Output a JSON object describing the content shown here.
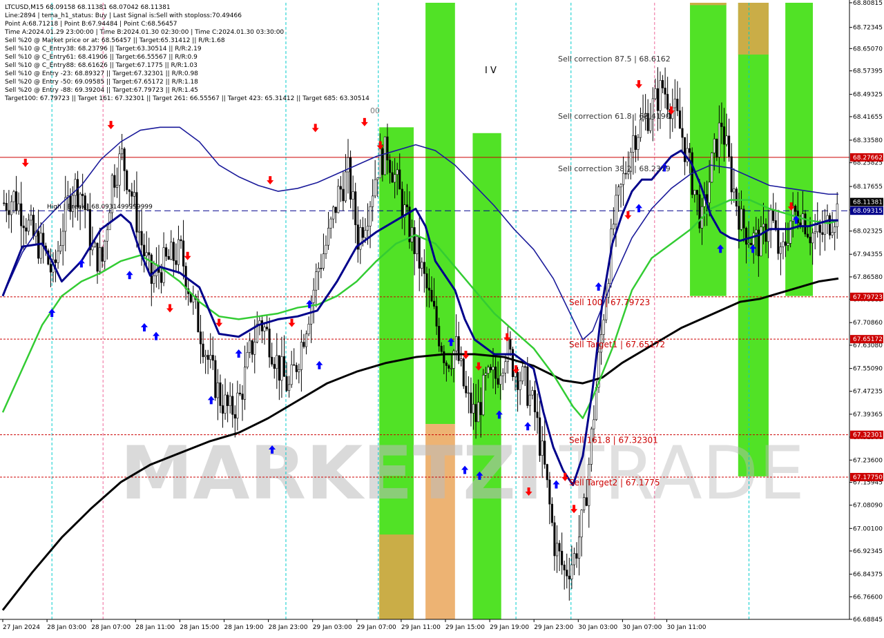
{
  "header": {
    "lines": [
      "LTCUSD,M15  68.09158 68.11381 68.07042 68.11381",
      "Line:2894  |  tema_h1_status: Buy  |  Last Signal is:Sell with stoploss:70.49466",
      "Point A:68.71218  |  Point B:67.94484  |  Point C:68.56457",
      "Time A:2024.01.29 23:00:00  |  Time B:2024.01.30 02:30:00  |  Time C:2024.01.30 03:30:00",
      "Sell %20 @ Market price or at: 68.56457  ||  Target:65.31412  ||  R/R:1.68",
      "Sell %10 @ C_Entry38: 68.23796  ||  Target:63.30514  ||  R/R:2.19",
      "Sell %10 @ C_Entry61: 68.41906  ||  Target:66.55567  ||  R/R:0.9",
      "Sell %10 @ C_Entry88: 68.61626  ||  Target:67.1775  ||  R/R:1.03",
      "Sell %10 @ Entry -23: 68.89327  ||  Target:67.32301  ||  R/R:0.98",
      "Sell %20 @ Entry -50: 69.09585  ||  Target:67.65172  ||  R/R:1.18",
      "Sell %20 @ Entry -88: 69.39204  ||  Target:67.79723  ||  R/R:1.45",
      "Target100: 67.79723  ||  Target 161: 67.32301  ||  Target 261: 66.55567  ||  Target 423: 65.31412  ||  Target 685: 63.30514"
    ]
  },
  "watermark": {
    "left": "MARKETZI",
    "right": "TRADE"
  },
  "wave_label": "I V",
  "partial_label": "00",
  "colors": {
    "background": "#ffffff",
    "plot_bg": "#ffffff",
    "zone_green": "#33dd00",
    "zone_orange": "#e8a050",
    "bull_body": "#ffffff",
    "bear_body": "#000000",
    "wick": "#000000",
    "ma_fast": "#00008b",
    "ma_mid": "#1a1a9a",
    "ma_green": "#33cc33",
    "ma_slow": "#000000",
    "level_red": "#cc0000",
    "bid_line": "#00008b",
    "arrow_up": "#0000ff",
    "arrow_down": "#ff0000",
    "tag_red_bg": "#cc0000",
    "tag_blue_bg": "#00008b"
  },
  "chart_data": {
    "type": "candlestick",
    "symbol": "LTCUSD",
    "timeframe": "M15",
    "ylim": [
      66.6884,
      68.8081
    ],
    "y_ticks": [
      "68.80815",
      "68.72345",
      "68.65070",
      "68.57395",
      "68.49325",
      "68.41655",
      "68.33580",
      "68.25825",
      "68.17655",
      "68.09585",
      "68.02325",
      "67.94355",
      "67.86580",
      "67.78885",
      "67.70860",
      "67.63080",
      "67.55090",
      "67.47235",
      "67.39365",
      "67.31500",
      "67.23600",
      "67.15945",
      "67.08090",
      "67.00100",
      "66.92345",
      "66.84375",
      "66.76600",
      "66.68845"
    ],
    "x_ticks": [
      "27 Jan 2024",
      "28 Jan 03:00",
      "28 Jan 07:00",
      "28 Jan 11:00",
      "28 Jan 15:00",
      "28 Jan 19:00",
      "28 Jan 23:00",
      "29 Jan 03:00",
      "29 Jan 07:00",
      "29 Jan 11:00",
      "29 Jan 15:00",
      "29 Jan 19:00",
      "29 Jan 23:00",
      "30 Jan 03:00",
      "30 Jan 07:00",
      "30 Jan 11:00"
    ],
    "levels": [
      {
        "name": "stop",
        "value": 68.27662,
        "tag": "68.27662",
        "style": "solid",
        "label": ""
      },
      {
        "name": "sell-100",
        "value": 67.79723,
        "tag": "67.79723",
        "style": "dotted",
        "label": "Sell 100 | 67.79723"
      },
      {
        "name": "sell-target1",
        "value": 67.65172,
        "tag": "67.65172",
        "style": "dotted",
        "label": "Sell Target1 | 67.65172"
      },
      {
        "name": "sell-161",
        "value": 67.32301,
        "tag": "67.32301",
        "style": "dotted",
        "label": "Sell 161.8 | 67.32301"
      },
      {
        "name": "sell-target2",
        "value": 67.1775,
        "tag": "67.17750",
        "style": "dotted",
        "label": "Sell Target2 | 67.1775"
      }
    ],
    "bid": {
      "value": 68.09315,
      "tag": "68.09315",
      "last": "68.11381",
      "label": "High | Break | 68.0931499999999"
    },
    "corrections": [
      {
        "text": "Sell correction 87.5 | 68.6162",
        "value": 68.6162
      },
      {
        "text": "Sell correction 61.8 | 68.4190",
        "value": 68.419
      },
      {
        "text": "Sell correction 38.2 | 68.2379",
        "value": 68.2379
      }
    ],
    "zones": [
      {
        "color": "green",
        "x": [
          38.3,
          41.8
        ],
        "y": [
          66.6884,
          68.38
        ]
      },
      {
        "color": "orange",
        "x": [
          38.3,
          41.8
        ],
        "y": [
          66.6884,
          66.98
        ]
      },
      {
        "color": "green",
        "x": [
          43.0,
          46.0
        ],
        "y": [
          67.36,
          68.8081
        ]
      },
      {
        "color": "orange",
        "x": [
          43.0,
          46.0
        ],
        "y": [
          66.6884,
          67.36
        ]
      },
      {
        "color": "green",
        "x": [
          47.8,
          50.7
        ],
        "y": [
          66.6884,
          68.36
        ]
      },
      {
        "color": "green",
        "x": [
          69.9,
          73.6
        ],
        "y": [
          67.8,
          68.8081
        ]
      },
      {
        "color": "orange",
        "x": [
          69.9,
          73.6
        ],
        "y": [
          68.8,
          68.8081
        ]
      },
      {
        "color": "green",
        "x": [
          74.8,
          77.9
        ],
        "y": [
          67.18,
          68.8081
        ]
      },
      {
        "color": "orange",
        "x": [
          74.8,
          77.9
        ],
        "y": [
          68.63,
          68.8081
        ]
      },
      {
        "color": "green",
        "x": [
          79.6,
          82.4
        ],
        "y": [
          67.8,
          68.8081
        ]
      }
    ],
    "cyan_markers": [
      5.0,
      28.8,
      38.2,
      52.2,
      57.8,
      75.9
    ],
    "pink_markers": [
      10.2,
      66.3
    ],
    "ma_slow": [
      [
        0,
        66.72
      ],
      [
        3,
        66.85
      ],
      [
        6,
        66.97
      ],
      [
        9,
        67.07
      ],
      [
        12,
        67.16
      ],
      [
        15,
        67.22
      ],
      [
        18,
        67.26
      ],
      [
        21,
        67.3
      ],
      [
        24,
        67.33
      ],
      [
        27,
        67.38
      ],
      [
        30,
        67.44
      ],
      [
        33,
        67.5
      ],
      [
        36,
        67.54
      ],
      [
        39,
        67.57
      ],
      [
        42,
        67.59
      ],
      [
        45,
        67.6
      ],
      [
        48,
        67.6
      ],
      [
        51,
        67.59
      ],
      [
        54,
        67.56
      ],
      [
        57,
        67.51
      ],
      [
        59,
        67.5
      ],
      [
        61,
        67.52
      ],
      [
        63,
        67.57
      ],
      [
        65,
        67.61
      ],
      [
        67,
        67.65
      ],
      [
        69,
        67.69
      ],
      [
        71,
        67.72
      ],
      [
        73,
        67.75
      ],
      [
        75,
        67.78
      ],
      [
        77,
        67.79
      ],
      [
        79,
        67.81
      ],
      [
        81,
        67.83
      ],
      [
        83,
        67.85
      ],
      [
        85,
        67.86
      ]
    ],
    "ma_green": [
      [
        0,
        67.4
      ],
      [
        2,
        67.55
      ],
      [
        4,
        67.7
      ],
      [
        6,
        67.8
      ],
      [
        8,
        67.85
      ],
      [
        10,
        67.88
      ],
      [
        12,
        67.92
      ],
      [
        14,
        67.94
      ],
      [
        16,
        67.9
      ],
      [
        18,
        67.85
      ],
      [
        20,
        67.78
      ],
      [
        22,
        67.73
      ],
      [
        24,
        67.72
      ],
      [
        26,
        67.73
      ],
      [
        28,
        67.74
      ],
      [
        30,
        67.76
      ],
      [
        32,
        67.77
      ],
      [
        34,
        67.8
      ],
      [
        36,
        67.85
      ],
      [
        38,
        67.92
      ],
      [
        40,
        67.98
      ],
      [
        42,
        68.01
      ],
      [
        44,
        67.98
      ],
      [
        46,
        67.9
      ],
      [
        48,
        67.82
      ],
      [
        50,
        67.74
      ],
      [
        52,
        67.68
      ],
      [
        54,
        67.62
      ],
      [
        56,
        67.53
      ],
      [
        58,
        67.42
      ],
      [
        59,
        67.38
      ],
      [
        60,
        67.45
      ],
      [
        62,
        67.62
      ],
      [
        64,
        67.82
      ],
      [
        66,
        67.93
      ],
      [
        68,
        67.98
      ],
      [
        70,
        68.03
      ],
      [
        72,
        68.1
      ],
      [
        74,
        68.13
      ],
      [
        76,
        68.13
      ],
      [
        78,
        68.1
      ],
      [
        80,
        68.08
      ],
      [
        82,
        68.06
      ],
      [
        84,
        68.05
      ],
      [
        85,
        68.06
      ]
    ],
    "ma_mid": [
      [
        0,
        67.8
      ],
      [
        2,
        67.95
      ],
      [
        4,
        68.05
      ],
      [
        6,
        68.12
      ],
      [
        8,
        68.18
      ],
      [
        10,
        68.27
      ],
      [
        12,
        68.33
      ],
      [
        14,
        68.37
      ],
      [
        16,
        68.38
      ],
      [
        18,
        68.38
      ],
      [
        20,
        68.33
      ],
      [
        22,
        68.25
      ],
      [
        24,
        68.21
      ],
      [
        26,
        68.18
      ],
      [
        28,
        68.16
      ],
      [
        30,
        68.17
      ],
      [
        32,
        68.19
      ],
      [
        34,
        68.22
      ],
      [
        36,
        68.25
      ],
      [
        38,
        68.28
      ],
      [
        40,
        68.3
      ],
      [
        42,
        68.32
      ],
      [
        44,
        68.3
      ],
      [
        46,
        68.25
      ],
      [
        48,
        68.18
      ],
      [
        50,
        68.11
      ],
      [
        52,
        68.03
      ],
      [
        54,
        67.96
      ],
      [
        56,
        67.86
      ],
      [
        58,
        67.72
      ],
      [
        59,
        67.65
      ],
      [
        60,
        67.68
      ],
      [
        62,
        67.85
      ],
      [
        64,
        68.0
      ],
      [
        66,
        68.1
      ],
      [
        68,
        68.17
      ],
      [
        70,
        68.22
      ],
      [
        72,
        68.25
      ],
      [
        74,
        68.24
      ],
      [
        76,
        68.21
      ],
      [
        78,
        68.18
      ],
      [
        80,
        68.17
      ],
      [
        82,
        68.16
      ],
      [
        84,
        68.15
      ],
      [
        85,
        68.15
      ]
    ],
    "ma_fast": [
      [
        0,
        67.8
      ],
      [
        2,
        67.97
      ],
      [
        4,
        67.98
      ],
      [
        5,
        67.92
      ],
      [
        6,
        67.85
      ],
      [
        8,
        67.92
      ],
      [
        10,
        68.03
      ],
      [
        12,
        68.08
      ],
      [
        13,
        68.05
      ],
      [
        14,
        67.95
      ],
      [
        15,
        67.87
      ],
      [
        16,
        67.9
      ],
      [
        18,
        67.88
      ],
      [
        20,
        67.83
      ],
      [
        21,
        67.75
      ],
      [
        22,
        67.67
      ],
      [
        24,
        67.66
      ],
      [
        26,
        67.7
      ],
      [
        28,
        67.72
      ],
      [
        30,
        67.73
      ],
      [
        32,
        67.75
      ],
      [
        34,
        67.85
      ],
      [
        36,
        67.97
      ],
      [
        38,
        68.02
      ],
      [
        40,
        68.06
      ],
      [
        42,
        68.1
      ],
      [
        43,
        68.04
      ],
      [
        44,
        67.92
      ],
      [
        46,
        67.82
      ],
      [
        47,
        67.72
      ],
      [
        48,
        67.65
      ],
      [
        50,
        67.6
      ],
      [
        52,
        67.6
      ],
      [
        54,
        67.55
      ],
      [
        55,
        67.4
      ],
      [
        56,
        67.28
      ],
      [
        57,
        67.2
      ],
      [
        58,
        67.15
      ],
      [
        59,
        67.25
      ],
      [
        60,
        67.48
      ],
      [
        61,
        67.78
      ],
      [
        62,
        67.98
      ],
      [
        63,
        68.08
      ],
      [
        64,
        68.16
      ],
      [
        65,
        68.2
      ],
      [
        66,
        68.2
      ],
      [
        67,
        68.24
      ],
      [
        68,
        68.28
      ],
      [
        69,
        68.3
      ],
      [
        70,
        68.26
      ],
      [
        71,
        68.18
      ],
      [
        72,
        68.08
      ],
      [
        73,
        68.02
      ],
      [
        74,
        68.0
      ],
      [
        75,
        67.99
      ],
      [
        76,
        68.0
      ],
      [
        77,
        68.01
      ],
      [
        78,
        68.03
      ],
      [
        79,
        68.03
      ],
      [
        80,
        68.03
      ],
      [
        81,
        68.04
      ],
      [
        82,
        68.04
      ],
      [
        83,
        68.05
      ],
      [
        84,
        68.06
      ],
      [
        85,
        68.06
      ]
    ],
    "price_path": [
      [
        0,
        68.12
      ],
      [
        1,
        68.14
      ],
      [
        2,
        68.08
      ],
      [
        3,
        68.0
      ],
      [
        4,
        67.96
      ],
      [
        5,
        67.87
      ],
      [
        6,
        68.05
      ],
      [
        7,
        68.18
      ],
      [
        8,
        68.15
      ],
      [
        9,
        67.95
      ],
      [
        10,
        67.92
      ],
      [
        11,
        68.2
      ],
      [
        12,
        68.28
      ],
      [
        13,
        68.15
      ],
      [
        14,
        67.98
      ],
      [
        15,
        67.85
      ],
      [
        16,
        67.9
      ],
      [
        17,
        67.93
      ],
      [
        18,
        67.95
      ],
      [
        19,
        67.8
      ],
      [
        20,
        67.68
      ],
      [
        21,
        67.55
      ],
      [
        22,
        67.45
      ],
      [
        23,
        67.4
      ],
      [
        24,
        67.45
      ],
      [
        25,
        67.6
      ],
      [
        26,
        67.72
      ],
      [
        27,
        67.65
      ],
      [
        28,
        67.55
      ],
      [
        29,
        67.48
      ],
      [
        30,
        67.6
      ],
      [
        31,
        67.75
      ],
      [
        32,
        67.9
      ],
      [
        33,
        68.0
      ],
      [
        34,
        68.15
      ],
      [
        35,
        68.22
      ],
      [
        36,
        68.0
      ],
      [
        37,
        68.1
      ],
      [
        38,
        68.25
      ],
      [
        39,
        68.3
      ],
      [
        40,
        68.18
      ],
      [
        41,
        68.05
      ],
      [
        42,
        67.95
      ],
      [
        43,
        67.82
      ],
      [
        44,
        67.7
      ],
      [
        45,
        67.58
      ],
      [
        46,
        67.62
      ],
      [
        47,
        67.45
      ],
      [
        48,
        67.38
      ],
      [
        49,
        67.5
      ],
      [
        50,
        67.52
      ],
      [
        51,
        67.62
      ],
      [
        52,
        67.55
      ],
      [
        53,
        67.5
      ],
      [
        54,
        67.4
      ],
      [
        55,
        67.2
      ],
      [
        56,
        66.95
      ],
      [
        57,
        66.85
      ],
      [
        58,
        66.9
      ],
      [
        59,
        67.05
      ],
      [
        60,
        67.4
      ],
      [
        61,
        67.75
      ],
      [
        62,
        68.05
      ],
      [
        63,
        68.2
      ],
      [
        64,
        68.35
      ],
      [
        65,
        68.4
      ],
      [
        66,
        68.45
      ],
      [
        67,
        68.52
      ],
      [
        68,
        68.45
      ],
      [
        69,
        68.35
      ],
      [
        70,
        68.2
      ],
      [
        71,
        68.05
      ],
      [
        72,
        68.25
      ],
      [
        73,
        68.4
      ],
      [
        74,
        68.2
      ],
      [
        75,
        68.05
      ],
      [
        76,
        68.0
      ],
      [
        77,
        67.98
      ],
      [
        78,
        68.08
      ],
      [
        79,
        67.92
      ],
      [
        80,
        68.06
      ],
      [
        81,
        68.1
      ],
      [
        82,
        68.02
      ],
      [
        83,
        68.0
      ],
      [
        84,
        68.06
      ],
      [
        85,
        68.11
      ]
    ],
    "up_arrows": [
      [
        5.0,
        67.74
      ],
      [
        8.0,
        67.91
      ],
      [
        12.9,
        67.87
      ],
      [
        14.4,
        67.69
      ],
      [
        15.6,
        67.66
      ],
      [
        21.2,
        67.44
      ],
      [
        24.0,
        67.6
      ],
      [
        27.4,
        67.27
      ],
      [
        31.2,
        67.77
      ],
      [
        32.2,
        67.56
      ],
      [
        45.6,
        67.64
      ],
      [
        47.0,
        67.2
      ],
      [
        48.5,
        67.18
      ],
      [
        50.5,
        67.39
      ],
      [
        53.4,
        67.35
      ],
      [
        56.3,
        67.15
      ],
      [
        60.6,
        67.83
      ],
      [
        64.7,
        68.1
      ],
      [
        67.3,
        68.24
      ],
      [
        73.0,
        67.96
      ],
      [
        76.3,
        67.96
      ],
      [
        80.7,
        68.06
      ]
    ],
    "down_arrows": [
      [
        2.3,
        68.26
      ],
      [
        11.0,
        68.39
      ],
      [
        17.0,
        67.76
      ],
      [
        18.8,
        67.94
      ],
      [
        22.0,
        67.71
      ],
      [
        27.2,
        68.2
      ],
      [
        29.4,
        67.71
      ],
      [
        31.8,
        68.38
      ],
      [
        36.8,
        68.4
      ],
      [
        38.4,
        68.32
      ],
      [
        47.1,
        67.6
      ],
      [
        48.4,
        67.56
      ],
      [
        51.3,
        67.66
      ],
      [
        52.2,
        67.55
      ],
      [
        53.5,
        67.13
      ],
      [
        57.2,
        67.18
      ],
      [
        58.1,
        67.07
      ],
      [
        63.6,
        68.08
      ],
      [
        64.7,
        68.53
      ],
      [
        68.0,
        68.44
      ],
      [
        80.2,
        68.11
      ]
    ]
  }
}
